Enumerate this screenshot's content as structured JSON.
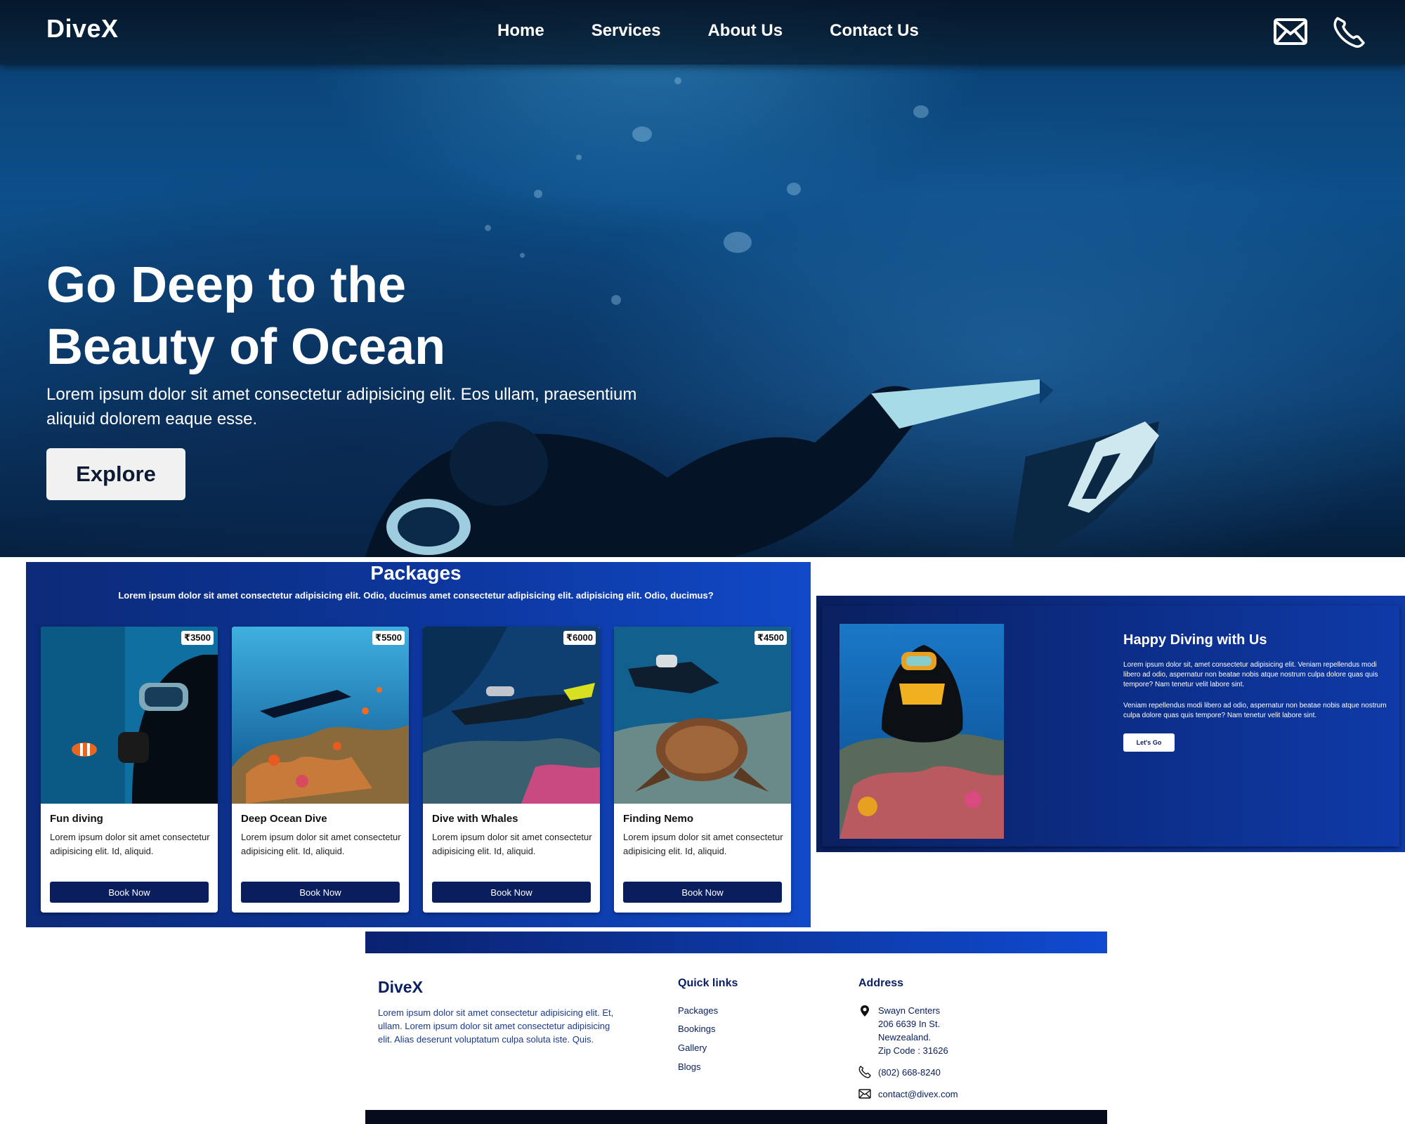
{
  "nav": {
    "logo": "DiveX",
    "links": [
      "Home",
      "Services",
      "About Us",
      "Contact Us"
    ],
    "icons": [
      "mail-icon",
      "phone-icon"
    ]
  },
  "hero": {
    "title_line1": "Go Deep to the",
    "title_line2": "Beauty of Ocean",
    "subtitle": "Lorem ipsum dolor sit amet consectetur adipisicing elit. Eos ullam, praesentium aliquid dolorem eaque esse.",
    "cta": "Explore"
  },
  "packages": {
    "title": "Packages",
    "subtitle": "Lorem ipsum dolor sit amet consectetur adipisicing elit. Odio, ducimus amet consectetur adipisicing elit. adipisicing elit. Odio, ducimus?",
    "cards": [
      {
        "price": "₹3500",
        "title": "Fun diving",
        "desc": "Lorem ipsum dolor sit amet consectetur adipisicing elit. Id, aliquid.",
        "button": "Book Now"
      },
      {
        "price": "₹5500",
        "title": "Deep Ocean Dive",
        "desc": "Lorem ipsum dolor sit amet consectetur adipisicing elit. Id, aliquid.",
        "button": "Book Now"
      },
      {
        "price": "₹6000",
        "title": "Dive with Whales",
        "desc": "Lorem ipsum dolor sit amet consectetur adipisicing elit. Id, aliquid.",
        "button": "Book Now"
      },
      {
        "price": "₹4500",
        "title": "Finding Nemo",
        "desc": "Lorem ipsum dolor sit amet consectetur adipisicing elit. Id, aliquid.",
        "button": "Book Now"
      }
    ]
  },
  "about": {
    "title": "Happy Diving with Us",
    "p1": "Lorem ipsum dolor sit, amet consectetur adipisicing elit. Veniam repellendus modi libero ad odio, aspernatur non beatae nobis atque nostrum culpa dolore quas quis tempore? Nam tenetur velit labore sint.",
    "p2": "Veniam repellendus modi libero ad odio, aspernatur non beatae nobis atque nostrum culpa dolore quas quis tempore? Nam tenetur velit labore sint.",
    "button": "Let's Go"
  },
  "footer": {
    "logo": "DiveX",
    "desc": "Lorem ipsum dolor sit amet consectetur adipisicing elit. Et, ullam. Lorem ipsum dolor sit amet consectetur adipisicing elit. Alias deserunt voluptatum culpa soluta iste. Quis.",
    "quick_title": "Quick links",
    "quick_links": [
      "Packages",
      "Bookings",
      "Gallery",
      "Blogs"
    ],
    "address_title": "Address",
    "address_lines": [
      "Swayn Centers",
      "206 6639 In St.",
      "Newzealand.",
      "Zip Code : 31626"
    ],
    "phone": "(802) 668-8240",
    "email": "contact@divex.com"
  },
  "colors": {
    "primary": "#0a1e5e",
    "accent": "#0d39a3",
    "text_light": "#ffffff"
  }
}
